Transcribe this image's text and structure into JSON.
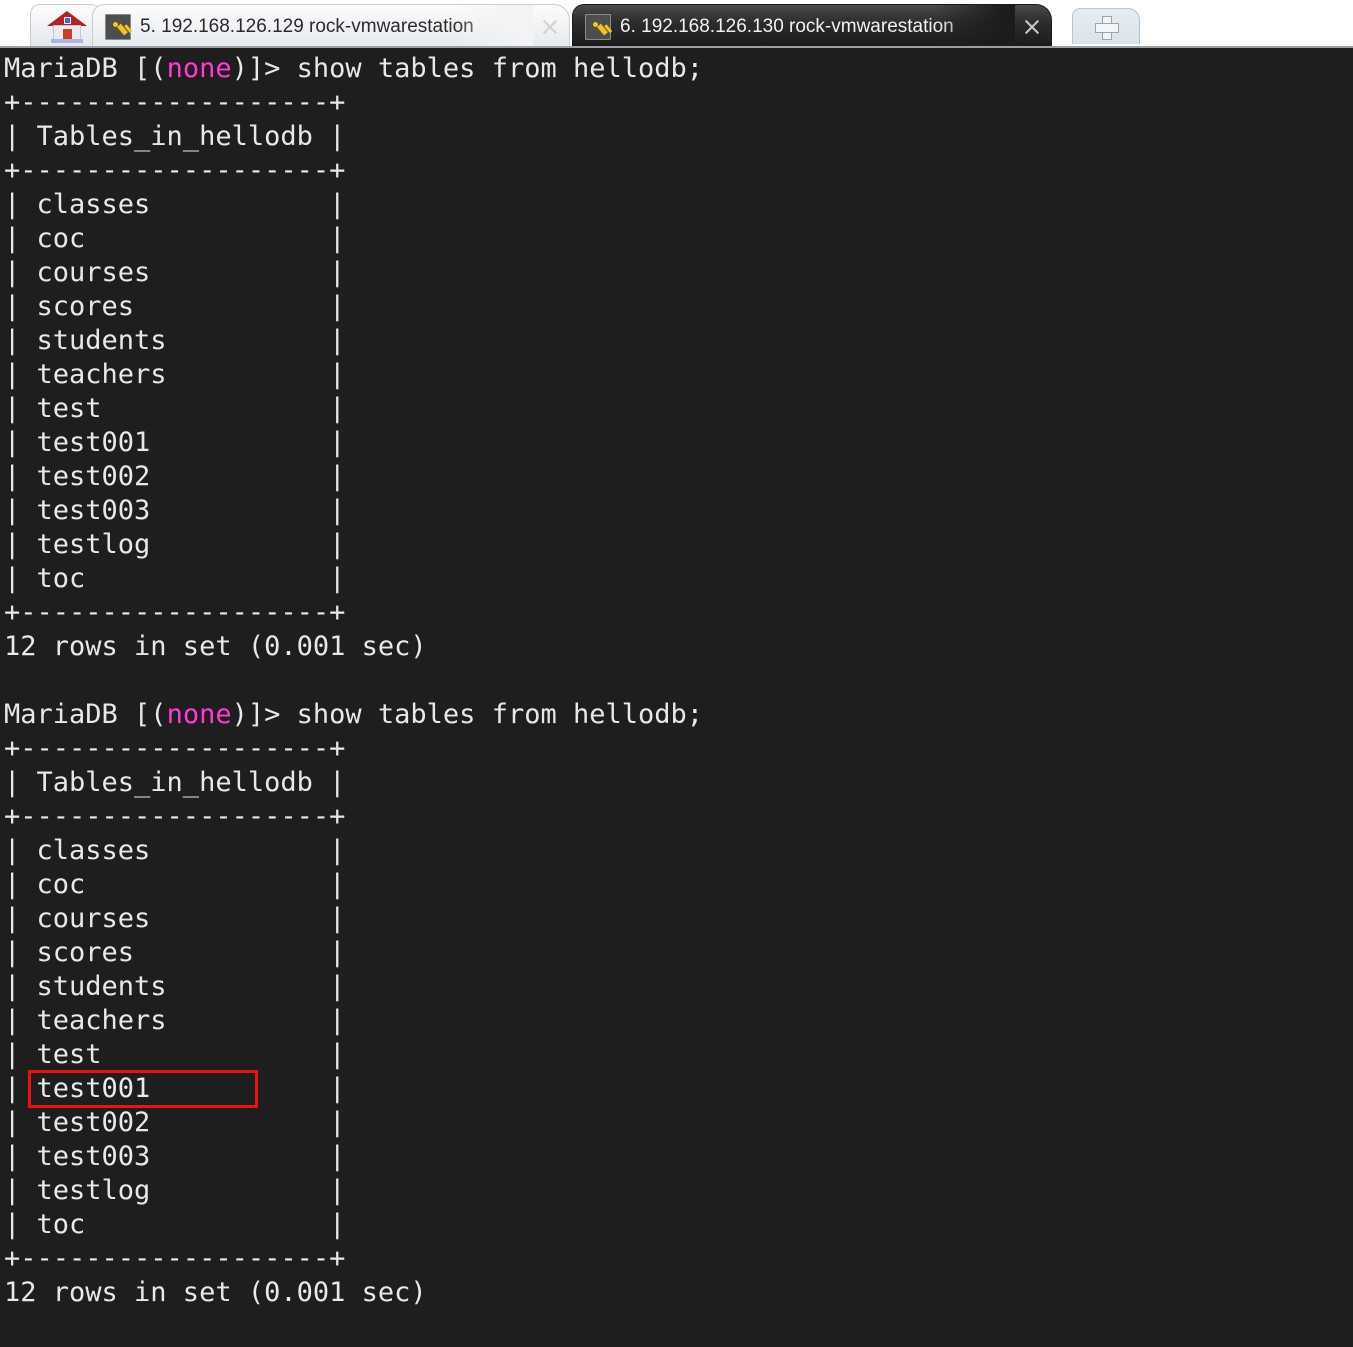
{
  "window": {
    "app": "xshell-terminal",
    "background_color": "#1e1e1e",
    "foreground_color": "#e8e8e8",
    "accent_magenta": "#ff3ad6",
    "highlight_color": "#ee1111"
  },
  "tabbar": {
    "home_tab": {
      "icon": "house-icon",
      "label": ""
    },
    "new_tab": {
      "icon": "plus-icon",
      "label": ""
    },
    "tabs": [
      {
        "label": "5. 192.168.126.129 rock-vmwarestation",
        "icon": "key-icon",
        "active": false,
        "close_label": "×"
      },
      {
        "label": "6. 192.168.126.130 rock-vmwarestation",
        "icon": "key-icon",
        "active": true,
        "close_label": "×"
      }
    ]
  },
  "terminal": {
    "prompt_prefix": "MariaDB [(",
    "prompt_db": "none",
    "prompt_suffix": ")]> ",
    "command": "show tables from hellodb;",
    "separator": "+-------------------+",
    "header_row": "| Tables_in_hellodb |",
    "rows": [
      "| classes           |",
      "| coc               |",
      "| courses           |",
      "| scores            |",
      "| students          |",
      "| teachers          |",
      "| test              |",
      "| test001           |",
      "| test002           |",
      "| test003           |",
      "| testlog           |",
      "| toc               |"
    ],
    "footer": "12 rows in set (0.001 sec)",
    "blank": " ",
    "table_names": [
      "classes",
      "coc",
      "courses",
      "scores",
      "students",
      "teachers",
      "test",
      "test001",
      "test002",
      "test003",
      "testlog",
      "toc"
    ],
    "row_count": 12,
    "elapsed_sec": "0.001",
    "database": "hellodb",
    "highlighted_row": "test001"
  }
}
